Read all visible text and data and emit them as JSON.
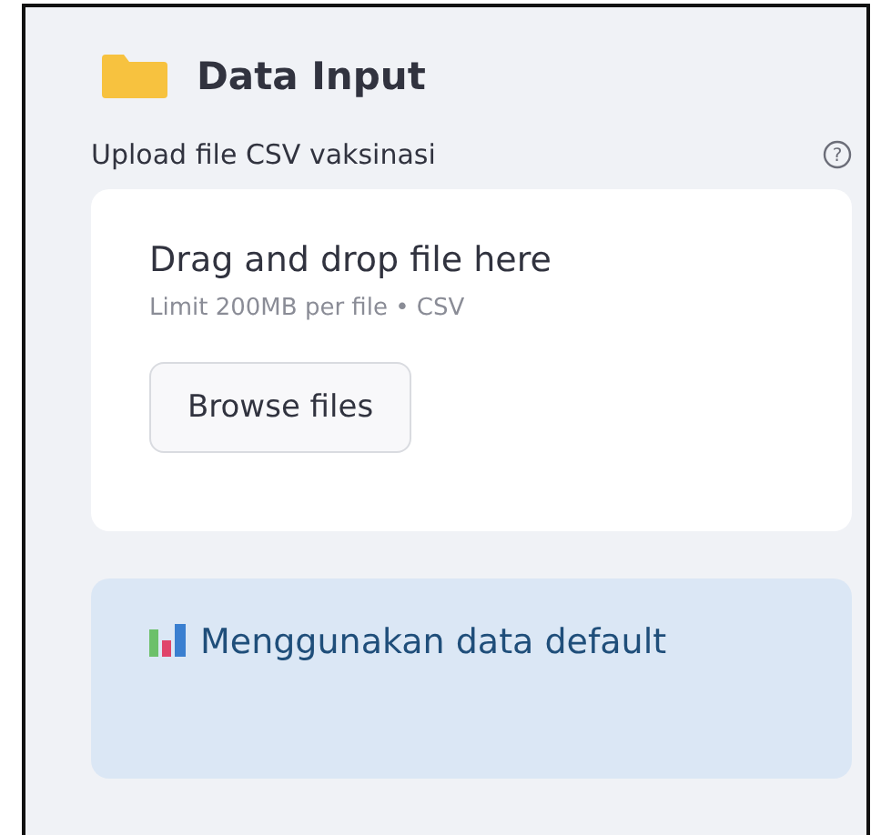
{
  "header": {
    "title": "Data Input"
  },
  "uploader": {
    "label": "Upload file CSV vaksinasi",
    "help": "?",
    "drop_text": "Drag and drop file here",
    "limit_text": "Limit 200MB per file • CSV",
    "button": "Browse files"
  },
  "info": {
    "text": "Menggunakan data default"
  }
}
